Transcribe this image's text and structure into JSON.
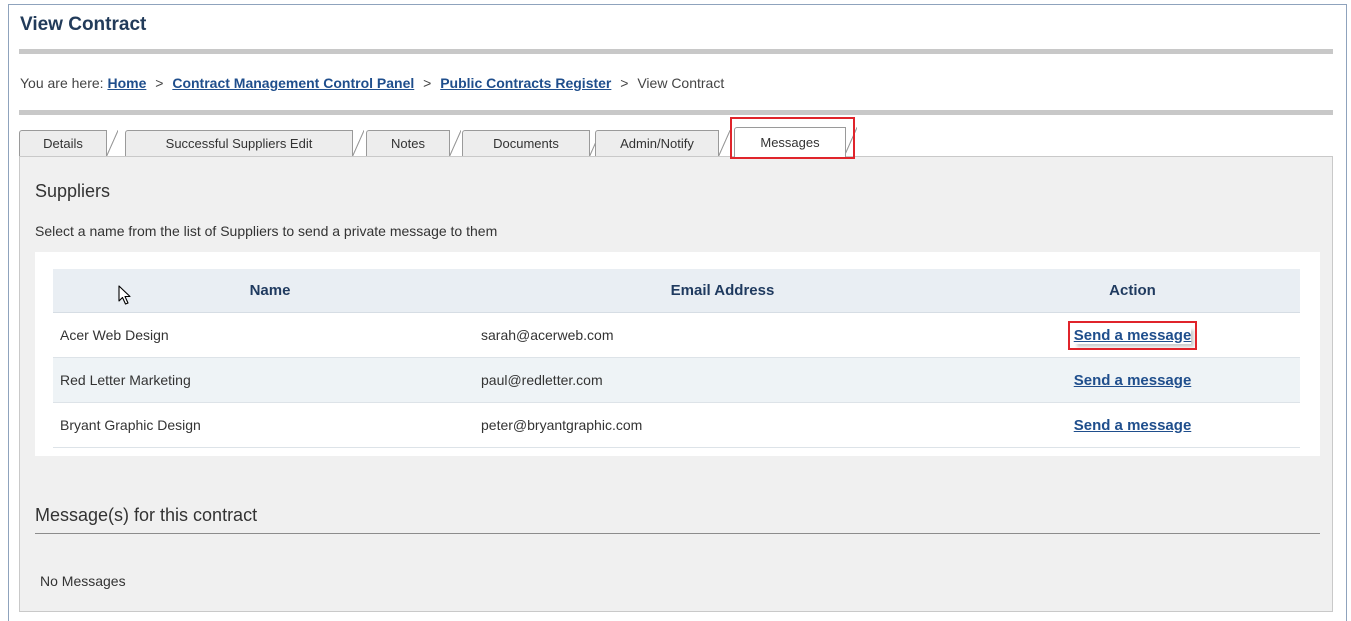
{
  "page": {
    "title": "View Contract"
  },
  "breadcrumb": {
    "prefix": "You are here:",
    "items": [
      {
        "label": "Home",
        "link": true
      },
      {
        "label": "Contract Management Control Panel",
        "link": true
      },
      {
        "label": "Public Contracts Register",
        "link": true
      },
      {
        "label": "View Contract",
        "link": false
      }
    ],
    "separator": ">"
  },
  "tabs": [
    {
      "label": "Details"
    },
    {
      "label": "Successful Suppliers Edit"
    },
    {
      "label": "Notes"
    },
    {
      "label": "Documents"
    },
    {
      "label": "Admin/Notify"
    },
    {
      "label": "Messages",
      "active": true
    }
  ],
  "suppliers": {
    "title": "Suppliers",
    "description": "Select a name from the list of Suppliers to send a private message to them",
    "columns": {
      "name": "Name",
      "email": "Email Address",
      "action": "Action"
    },
    "rows": [
      {
        "name": "Acer Web Design",
        "email": "sarah@acerweb.com",
        "action": "Send a message"
      },
      {
        "name": "Red Letter Marketing",
        "email": "paul@redletter.com",
        "action": "Send a message"
      },
      {
        "name": "Bryant Graphic Design",
        "email": "peter@bryantgraphic.com",
        "action": "Send a message"
      }
    ]
  },
  "messages": {
    "title": "Message(s) for this contract",
    "empty_text": "No Messages"
  },
  "colors": {
    "link": "#1f4e8c",
    "highlight": "#e0242b",
    "title": "#223b5a"
  },
  "icons": {
    "cursor": "mouse-pointer-icon"
  }
}
